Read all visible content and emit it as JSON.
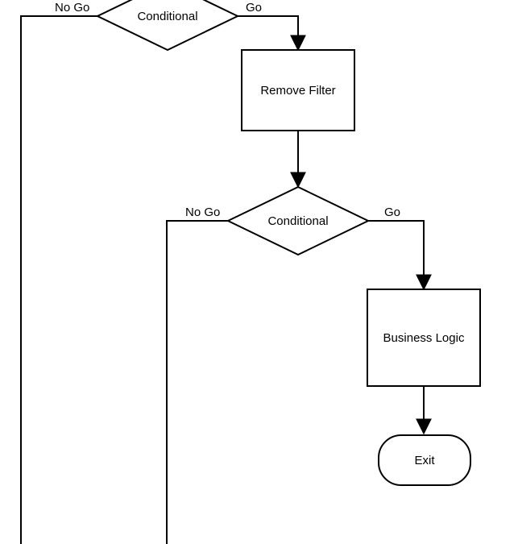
{
  "flowchart": {
    "nodes": {
      "conditional1": {
        "label": "Conditional",
        "type": "decision"
      },
      "remove_filter": {
        "label": "Remove Filter",
        "type": "process"
      },
      "conditional2": {
        "label": "Conditional",
        "type": "decision"
      },
      "business_logic": {
        "label": "Business Logic",
        "type": "process"
      },
      "exit": {
        "label": "Exit",
        "type": "terminator"
      }
    },
    "edges": {
      "c1_go": "Go",
      "c1_nogo": "No Go",
      "c2_go": "Go",
      "c2_nogo": "No Go"
    }
  }
}
